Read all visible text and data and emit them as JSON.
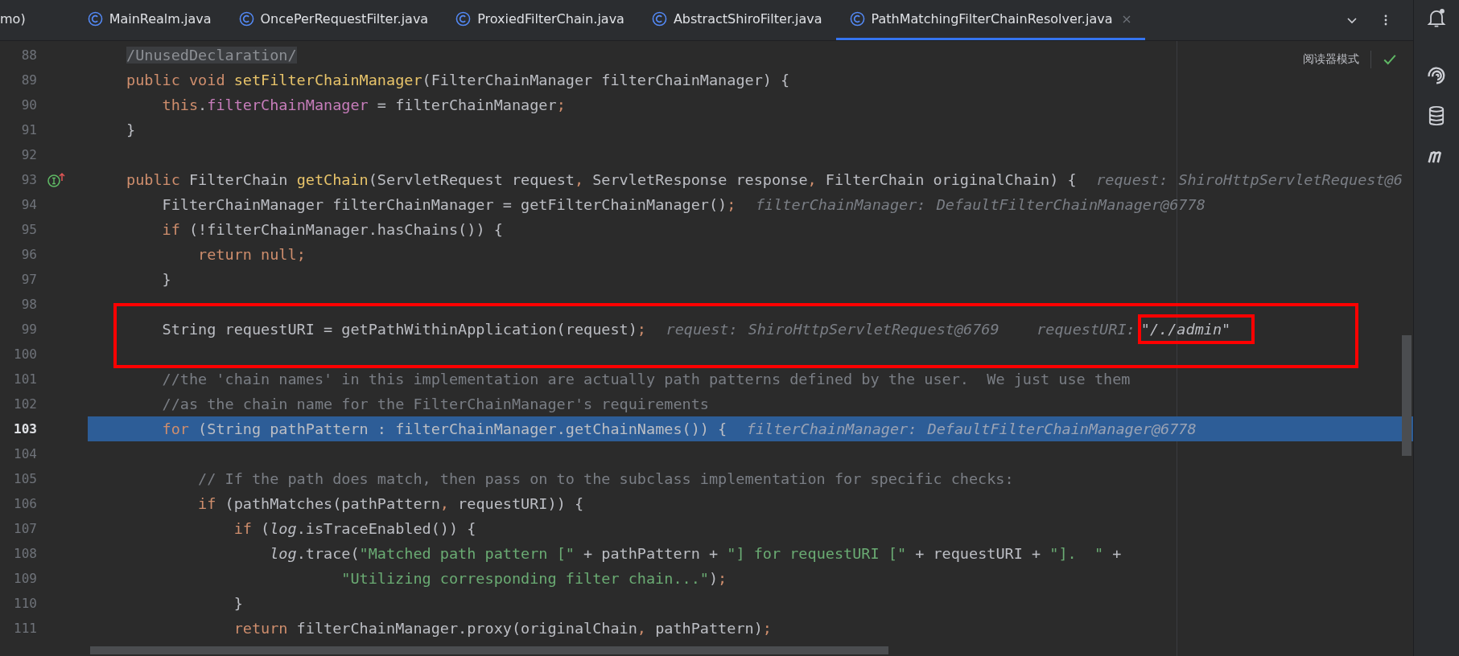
{
  "tabs": [
    {
      "label": "mo)",
      "selected": false,
      "icon": false,
      "closable": false
    },
    {
      "label": "MainRealm.java",
      "selected": false,
      "icon": true,
      "closable": false
    },
    {
      "label": "OncePerRequestFilter.java",
      "selected": false,
      "icon": true,
      "closable": false
    },
    {
      "label": "ProxiedFilterChain.java",
      "selected": false,
      "icon": true,
      "closable": false
    },
    {
      "label": "AbstractShiroFilter.java",
      "selected": false,
      "icon": true,
      "closable": false
    },
    {
      "label": "PathMatchingFilterChainResolver.java",
      "selected": true,
      "icon": true,
      "closable": true
    }
  ],
  "reader_mode": {
    "label": "阅读器模式"
  },
  "blocks": [
    {
      "framed": false,
      "lines": [
        {
          "number": "88",
          "kind": "nest0",
          "current": false,
          "marker": false,
          "tokens": [
            {
              "t": "/UnusedDeclaration/",
              "kind": "suppressed"
            }
          ]
        },
        {
          "number": "89",
          "kind": "nest0",
          "current": false,
          "marker": false,
          "tokens": [
            {
              "t": "public void ",
              "kind": "keyword"
            },
            {
              "t": "setFilterChainManager",
              "kind": "method"
            },
            {
              "t": "(FilterChainManager filterChainManager) {",
              "kind": "plain"
            }
          ]
        },
        {
          "number": "90",
          "kind": "nest1",
          "current": false,
          "marker": false,
          "tokens": [
            {
              "t": "this",
              "kind": "keyword"
            },
            {
              "t": ".",
              "kind": "plain"
            },
            {
              "t": "filterChainManager",
              "kind": "field"
            },
            {
              "t": " = filterChainManager",
              "kind": "plain"
            },
            {
              "t": ";",
              "kind": "punct"
            }
          ]
        },
        {
          "number": "91",
          "kind": "nest0",
          "current": false,
          "marker": false,
          "tokens": [
            {
              "t": "}",
              "kind": "plain"
            }
          ]
        },
        {
          "number": "92",
          "kind": "nest0",
          "current": false,
          "marker": false
        },
        {
          "number": "93",
          "kind": "nest0",
          "current": false,
          "marker": true,
          "tokens": [
            {
              "t": "public ",
              "kind": "keyword"
            },
            {
              "t": "FilterChain ",
              "kind": "plain"
            },
            {
              "t": "getChain",
              "kind": "method"
            },
            {
              "t": "(ServletRequest request",
              "kind": "plain"
            },
            {
              "t": ", ",
              "kind": "punct"
            },
            {
              "t": "ServletResponse response",
              "kind": "plain"
            },
            {
              "t": ", ",
              "kind": "punct"
            },
            {
              "t": "FilterChain originalChain) {",
              "kind": "plain"
            }
          ],
          "hints": [
            {
              "label": "request:",
              "value": "ShiroHttpServletRequest@6",
              "boxed": false
            }
          ]
        },
        {
          "number": "94",
          "kind": "nest1",
          "current": false,
          "marker": false,
          "tokens": [
            {
              "t": "FilterChainManager filterChainManager = getFilterChainManager()",
              "kind": "plain"
            },
            {
              "t": ";",
              "kind": "punct"
            }
          ],
          "hints": [
            {
              "label": "filterChainManager:",
              "value": "DefaultFilterChainManager@6778",
              "boxed": false
            }
          ]
        },
        {
          "number": "95",
          "kind": "nest1",
          "current": false,
          "marker": false,
          "tokens": [
            {
              "t": "if ",
              "kind": "keyword"
            },
            {
              "t": "(!filterChainManager.hasChains()) {",
              "kind": "plain"
            }
          ]
        },
        {
          "number": "96",
          "kind": "nest2",
          "current": false,
          "marker": false,
          "tokens": [
            {
              "t": "return null",
              "kind": "keyword"
            },
            {
              "t": ";",
              "kind": "punct"
            }
          ]
        },
        {
          "number": "97",
          "kind": "nest1",
          "current": false,
          "marker": false,
          "tokens": [
            {
              "t": "}",
              "kind": "plain"
            }
          ]
        }
      ]
    },
    {
      "framed": true,
      "lines": [
        {
          "number": "98",
          "kind": "nest0",
          "current": false,
          "marker": false
        },
        {
          "number": "99",
          "kind": "nest1",
          "current": false,
          "marker": false,
          "tokens": [
            {
              "t": "String requestURI = getPathWithinApplication(request)",
              "kind": "plain"
            },
            {
              "t": ";",
              "kind": "punct"
            }
          ],
          "hints": [
            {
              "label": "request:",
              "value": "ShiroHttpServletRequest@6769",
              "boxed": false
            },
            {
              "label": "requestURI:",
              "value": "\"/./admin\"",
              "boxed": true
            }
          ]
        },
        {
          "number": "100",
          "kind": "nest0",
          "current": false,
          "marker": false
        }
      ]
    },
    {
      "framed": false,
      "lines": [
        {
          "number": "101",
          "kind": "nest1",
          "current": false,
          "marker": false,
          "tokens": [
            {
              "t": "//the 'chain names' in this implementation are actually path patterns defined by the user.  We just use them",
              "kind": "comment"
            }
          ]
        },
        {
          "number": "102",
          "kind": "nest1",
          "current": false,
          "marker": false,
          "tokens": [
            {
              "t": "//as the chain name for the FilterChainManager's requirements",
              "kind": "comment"
            }
          ]
        },
        {
          "number": "103",
          "kind": "nest1",
          "current": true,
          "marker": false,
          "tokens": [
            {
              "t": "for ",
              "kind": "keyword"
            },
            {
              "t": "(String pathPattern : filterChainManager.getChainNames()) {",
              "kind": "plain"
            }
          ],
          "hints": [
            {
              "label": "filterChainManager:",
              "value": "DefaultFilterChainManager@6778",
              "boxed": false
            }
          ]
        },
        {
          "number": "104",
          "kind": "nest0",
          "current": false,
          "marker": false
        },
        {
          "number": "105",
          "kind": "nest2",
          "current": false,
          "marker": false,
          "tokens": [
            {
              "t": "// If the path does match, then pass on to the subclass implementation for specific checks:",
              "kind": "comment"
            }
          ]
        },
        {
          "number": "106",
          "kind": "nest2",
          "current": false,
          "marker": false,
          "tokens": [
            {
              "t": "if ",
              "kind": "keyword"
            },
            {
              "t": "(pathMatches(pathPattern",
              "kind": "plain"
            },
            {
              "t": ", ",
              "kind": "punct"
            },
            {
              "t": "requestURI)) {",
              "kind": "plain"
            }
          ]
        },
        {
          "number": "107",
          "kind": "nest3",
          "current": false,
          "marker": false,
          "tokens": [
            {
              "t": "if ",
              "kind": "keyword"
            },
            {
              "t": "(",
              "kind": "plain"
            },
            {
              "t": "log",
              "kind": "static"
            },
            {
              "t": ".isTraceEnabled()) {",
              "kind": "plain"
            }
          ]
        },
        {
          "number": "108",
          "kind": "nest4",
          "current": false,
          "marker": false,
          "tokens": [
            {
              "t": "log",
              "kind": "static"
            },
            {
              "t": ".trace(",
              "kind": "plain"
            },
            {
              "t": "\"Matched path pattern [\"",
              "kind": "string"
            },
            {
              "t": " + pathPattern + ",
              "kind": "plain"
            },
            {
              "t": "\"] for requestURI [\"",
              "kind": "string"
            },
            {
              "t": " + requestURI + ",
              "kind": "plain"
            },
            {
              "t": "\"].  \"",
              "kind": "string"
            },
            {
              "t": " +",
              "kind": "plain"
            }
          ]
        },
        {
          "number": "109",
          "kind": "nest6",
          "current": false,
          "marker": false,
          "tokens": [
            {
              "t": "\"Utilizing corresponding filter chain...\"",
              "kind": "string"
            },
            {
              "t": ")",
              "kind": "plain"
            },
            {
              "t": ";",
              "kind": "punct"
            }
          ]
        },
        {
          "number": "110",
          "kind": "nest3",
          "current": false,
          "marker": false,
          "tokens": [
            {
              "t": "}",
              "kind": "plain"
            }
          ]
        },
        {
          "number": "111",
          "kind": "nest3",
          "current": false,
          "marker": false,
          "tokens": [
            {
              "t": "return ",
              "kind": "keyword"
            },
            {
              "t": "filterChainManager.proxy(originalChain",
              "kind": "plain"
            },
            {
              "t": ", ",
              "kind": "punct"
            },
            {
              "t": "pathPattern)",
              "kind": "plain"
            },
            {
              "t": ";",
              "kind": "punct"
            }
          ]
        }
      ]
    }
  ]
}
